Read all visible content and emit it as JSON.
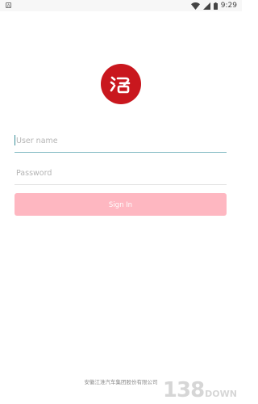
{
  "status_bar": {
    "left_icon": "notification-box-icon",
    "time": "9:29",
    "icons": [
      "wifi-icon",
      "cellular-signal-icon",
      "battery-icon"
    ]
  },
  "logo": {
    "name": "brand-logo",
    "glyph": "江淮",
    "color": "#c9171e"
  },
  "form": {
    "username_placeholder": "User name",
    "username_value": "",
    "password_placeholder": "Password",
    "password_value": "",
    "sign_in_label": "Sign In"
  },
  "footer": {
    "text": "安徽江淮汽车集团股份有限公司"
  },
  "watermark": {
    "main": "138",
    "sub": "DOWN"
  },
  "colors": {
    "accent_underline": "#7fb8c2",
    "button_bg": "#feb7c1",
    "logo_red": "#c9171e"
  }
}
